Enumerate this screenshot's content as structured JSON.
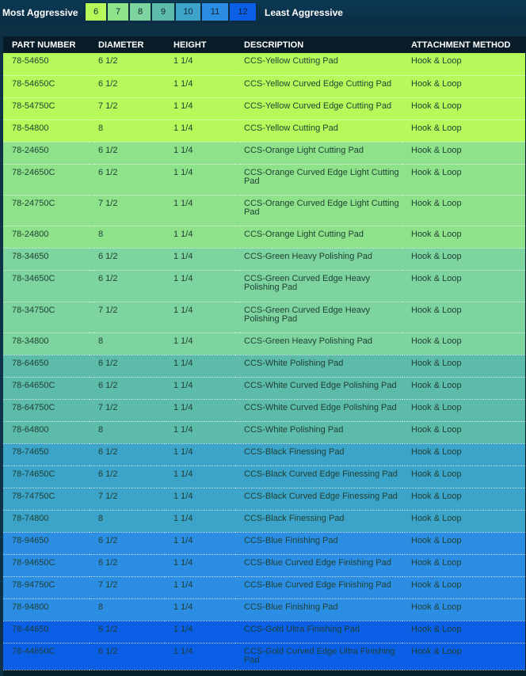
{
  "legend": {
    "most_label": "Most Aggressive",
    "least_label": "Least Aggressive",
    "levels": [
      {
        "label": "6",
        "color": "#b6f95a"
      },
      {
        "label": "7",
        "color": "#8ee38a"
      },
      {
        "label": "8",
        "color": "#7dd49f"
      },
      {
        "label": "9",
        "color": "#5dbbaa"
      },
      {
        "label": "10",
        "color": "#3ca4c8"
      },
      {
        "label": "11",
        "color": "#2b8ee2"
      },
      {
        "label": "12",
        "color": "#0a5fe6"
      }
    ]
  },
  "table": {
    "headers": [
      "PART NUMBER",
      "DIAMETER",
      "HEIGHT",
      "DESCRIPTION",
      "ATTACHMENT METHOD"
    ],
    "rows": [
      {
        "level": 0,
        "part": "78-54650",
        "diameter": "6 1/2",
        "height": "1 1/4",
        "description": "CCS-Yellow Cutting Pad",
        "attachment": "Hook & Loop"
      },
      {
        "level": 0,
        "part": "78-54650C",
        "diameter": "6 1/2",
        "height": "1 1/4",
        "description": "CCS-Yellow Curved Edge Cutting Pad",
        "attachment": "Hook & Loop"
      },
      {
        "level": 0,
        "part": "78-54750C",
        "diameter": "7 1/2",
        "height": "1 1/4",
        "description": "CCS-Yellow Curved Edge Cutting Pad",
        "attachment": "Hook & Loop"
      },
      {
        "level": 0,
        "part": "78-54800",
        "diameter": "8",
        "height": "1 1/4",
        "description": "CCS-Yellow Cutting Pad",
        "attachment": "Hook & Loop"
      },
      {
        "level": 1,
        "part": "78-24650",
        "diameter": "6 1/2",
        "height": "1 1/4",
        "description": "CCS-Orange Light Cutting Pad",
        "attachment": "Hook & Loop"
      },
      {
        "level": 1,
        "part": "78-24650C",
        "diameter": "6 1/2",
        "height": "1 1/4",
        "description": "CCS-Orange Curved Edge Light Cutting Pad",
        "attachment": "Hook & Loop"
      },
      {
        "level": 1,
        "part": "78-24750C",
        "diameter": "7 1/2",
        "height": "1 1/4",
        "description": "CCS-Orange Curved Edge Light Cutting Pad",
        "attachment": "Hook & Loop"
      },
      {
        "level": 1,
        "part": "78-24800",
        "diameter": "8",
        "height": "1 1/4",
        "description": "CCS-Orange Light Cutting Pad",
        "attachment": "Hook & Loop"
      },
      {
        "level": 2,
        "part": "78-34650",
        "diameter": "6 1/2",
        "height": "1 1/4",
        "description": "CCS-Green Heavy Polishing Pad",
        "attachment": "Hook & Loop"
      },
      {
        "level": 2,
        "part": "78-34650C",
        "diameter": "6 1/2",
        "height": "1 1/4",
        "description": "CCS-Green Curved Edge Heavy Polishing Pad",
        "attachment": "Hook & Loop"
      },
      {
        "level": 2,
        "part": "78-34750C",
        "diameter": "7 1/2",
        "height": "1 1/4",
        "description": "CCS-Green Curved Edge Heavy Polishing Pad",
        "attachment": "Hook & Loop"
      },
      {
        "level": 2,
        "part": "78-34800",
        "diameter": "8",
        "height": "1 1/4",
        "description": "CCS-Green Heavy Polishing Pad",
        "attachment": "Hook & Loop"
      },
      {
        "level": 3,
        "part": "78-64650",
        "diameter": "6 1/2",
        "height": "1 1/4",
        "description": "CCS-White Polishing Pad",
        "attachment": "Hook & Loop"
      },
      {
        "level": 3,
        "part": "78-64650C",
        "diameter": "6 1/2",
        "height": "1 1/4",
        "description": "CCS-White Curved Edge Polishing Pad",
        "attachment": "Hook & Loop"
      },
      {
        "level": 3,
        "part": "78-64750C",
        "diameter": "7 1/2",
        "height": "1 1/4",
        "description": "CCS-White Curved Edge Polishing Pad",
        "attachment": "Hook & Loop"
      },
      {
        "level": 3,
        "part": "78-64800",
        "diameter": "8",
        "height": "1 1/4",
        "description": "CCS-White Polishing Pad",
        "attachment": "Hook & Loop"
      },
      {
        "level": 4,
        "part": "78-74650",
        "diameter": "6 1/2",
        "height": "1 1/4",
        "description": "CCS-Black Finessing Pad",
        "attachment": "Hook & Loop"
      },
      {
        "level": 4,
        "part": "78-74650C",
        "diameter": "6 1/2",
        "height": "1 1/4",
        "description": "CCS-Black Curved Edge Finessing Pad",
        "attachment": "Hook & Loop"
      },
      {
        "level": 4,
        "part": "78-74750C",
        "diameter": "7 1/2",
        "height": "1 1/4",
        "description": "CCS-Black Curved Edge Finessing Pad",
        "attachment": "Hook & Loop"
      },
      {
        "level": 4,
        "part": "78-74800",
        "diameter": "8",
        "height": "1 1/4",
        "description": "CCS-Black Finessing Pad",
        "attachment": "Hook & Loop"
      },
      {
        "level": 5,
        "part": "78-94650",
        "diameter": "6 1/2",
        "height": "1 1/4",
        "description": "CCS-Blue Finishing Pad",
        "attachment": "Hook & Loop"
      },
      {
        "level": 5,
        "part": "78-94650C",
        "diameter": "6 1/2",
        "height": "1 1/4",
        "description": "CCS-Blue Curved Edge Finishing Pad",
        "attachment": "Hook & Loop"
      },
      {
        "level": 5,
        "part": "78-94750C",
        "diameter": "7 1/2",
        "height": "1 1/4",
        "description": "CCS-Blue Curved Edge Finishing Pad",
        "attachment": "Hook & Loop"
      },
      {
        "level": 5,
        "part": "78-94800",
        "diameter": "8",
        "height": "1 1/4",
        "description": "CCS-Blue Finishing Pad",
        "attachment": "Hook & Loop"
      },
      {
        "level": 6,
        "part": "78-44650",
        "diameter": "6 1/2",
        "height": "1 1/4",
        "description": "CCS-Gold Ultra Finishing Pad",
        "attachment": "Hook & Loop"
      },
      {
        "level": 6,
        "part": "78-44650C",
        "diameter": "6 1/2",
        "height": "1 1/4",
        "description": "CCS-Gold Curved Edge Ultra Finishing Pad",
        "attachment": "Hook & Loop"
      }
    ]
  }
}
